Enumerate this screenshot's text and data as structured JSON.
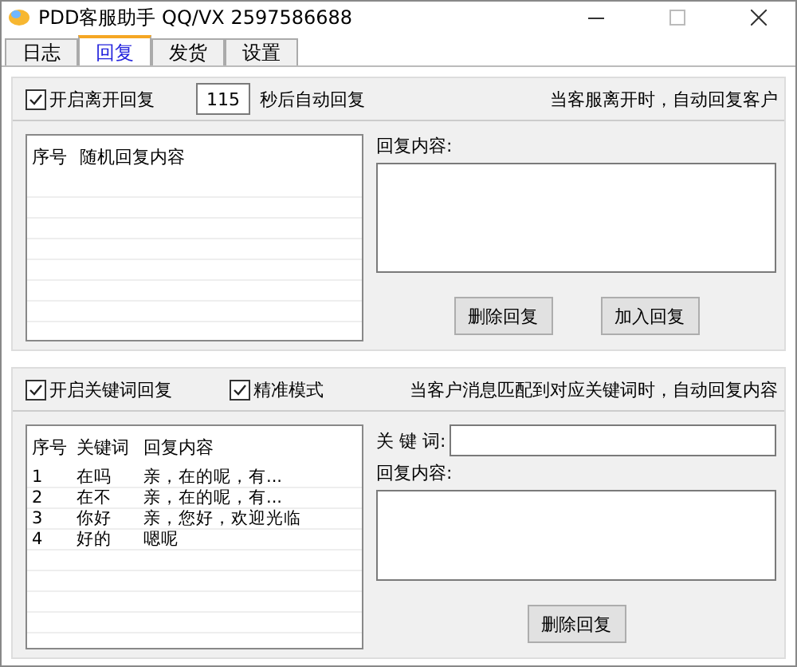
{
  "window": {
    "title": "PDD客服助手 QQ/VX 2597586688"
  },
  "tabs": [
    {
      "label": "日志",
      "selected": false
    },
    {
      "label": "回复",
      "selected": true
    },
    {
      "label": "发货",
      "selected": false
    },
    {
      "label": "设置",
      "selected": false
    }
  ],
  "away_reply": {
    "enable": {
      "label": "开启离开回复",
      "checked": true
    },
    "seconds": "115",
    "seconds_label": "秒后自动回复",
    "hint": "当客服离开时，自动回复客户",
    "table": {
      "columns": [
        "序号",
        "随机回复内容"
      ]
    },
    "content_label": "回复内容:",
    "buttons": [
      "删除回复",
      "加入回复"
    ]
  },
  "keyword_reply": {
    "enable": {
      "label": "开启关键词回复",
      "checked": true
    },
    "exact": {
      "label": "精准模式",
      "checked": true
    },
    "hint": "当客户消息匹配到对应关键词时，自动回复内容",
    "table": {
      "columns": [
        "序号",
        "关键词",
        "回复内容"
      ],
      "rows": [
        [
          "1",
          "在吗",
          "亲，在的呢，有..."
        ],
        [
          "2",
          "在不",
          "亲，在的呢，有..."
        ],
        [
          "3",
          "你好",
          "亲，您好，欢迎光临"
        ],
        [
          "4",
          "好的",
          "嗯呢"
        ]
      ]
    },
    "keyword_label": "关 键 词:",
    "content_label": "回复内容:",
    "buttons": [
      "删除回复"
    ]
  }
}
